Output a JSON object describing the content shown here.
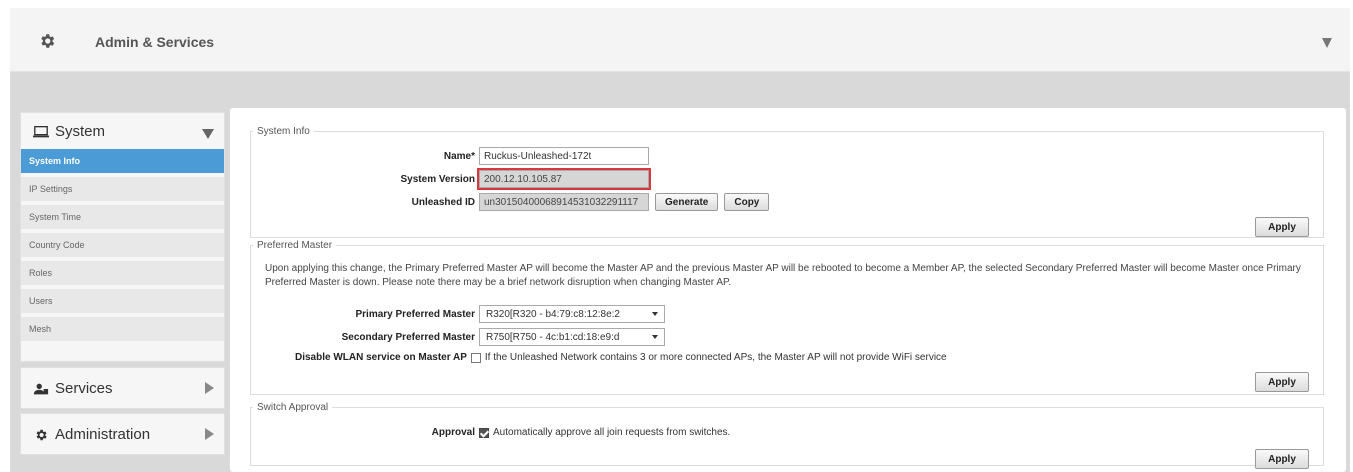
{
  "header": {
    "title": "Admin & Services"
  },
  "sidebar": {
    "system": {
      "title": "System",
      "items": [
        {
          "label": "System Info",
          "active": true
        },
        {
          "label": "IP Settings"
        },
        {
          "label": "System Time"
        },
        {
          "label": "Country Code"
        },
        {
          "label": "Roles"
        },
        {
          "label": "Users"
        },
        {
          "label": "Mesh"
        }
      ]
    },
    "services": {
      "title": "Services"
    },
    "administration": {
      "title": "Administration"
    }
  },
  "system_info": {
    "legend": "System Info",
    "name_label": "Name*",
    "name_value": "Ruckus-Unleashed-172t",
    "version_label": "System Version",
    "version_value": "200.12.10.105.87",
    "unleashed_id_label": "Unleashed ID",
    "unleashed_id_value": "un30150400068914531032291117",
    "generate_label": "Generate",
    "copy_label": "Copy",
    "apply_label": "Apply"
  },
  "preferred_master": {
    "legend": "Preferred Master",
    "description": "Upon applying this change, the Primary Preferred Master AP will become the Master AP and the previous Master AP will be rebooted to become a Member AP, the selected Secondary Preferred Master will become Master once Primary Preferred Master is down. Please note there may be a brief network disruption when changing Master AP.",
    "primary_label": "Primary Preferred Master",
    "primary_value": "R320[R320 - b4:79:c8:12:8e:2",
    "secondary_label": "Secondary Preferred Master",
    "secondary_value": "R750[R750 - 4c:b1:cd:18:e9:d",
    "disable_label": "Disable WLAN service on Master AP",
    "disable_text": "If the Unleashed Network contains 3 or more connected APs, the Master AP will not provide WiFi service",
    "apply_label": "Apply"
  },
  "switch_approval": {
    "legend": "Switch Approval",
    "approval_label": "Approval",
    "approval_text": "Automatically approve all join requests from switches.",
    "apply_label": "Apply"
  }
}
